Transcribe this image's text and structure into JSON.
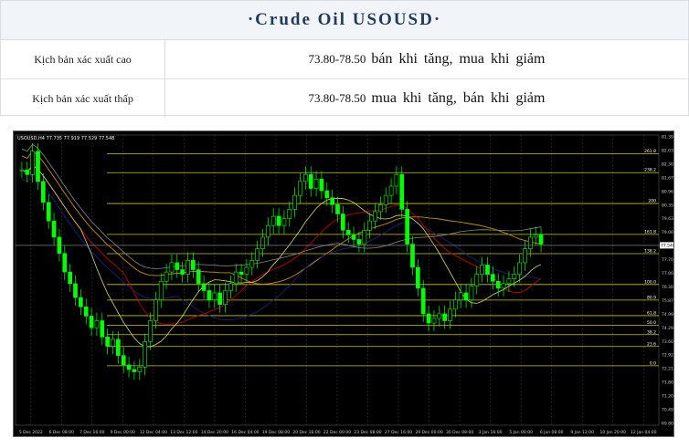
{
  "header": {
    "title": "·Crude  Oil  USOUSD·"
  },
  "scenarios": [
    {
      "label": "Kịch bản xác xuất cao",
      "range": "73.80-78.50",
      "action": "bán khi tăng, mua khi giảm"
    },
    {
      "label": "Kịch bản xác xuất thấp",
      "range": "73.80-78.50",
      "action": "mua khi tăng, bán khi giảm"
    }
  ],
  "colors": {
    "fib_line": "#c8c800",
    "candle": "#00ff00",
    "background": "#000000",
    "ma_red": "#c00000",
    "ma_orange": "#c89000",
    "ma_yellow": "#d8d860",
    "ma_grey": "#888888",
    "ma_blue": "#202080"
  },
  "chart_data": {
    "type": "candlestick",
    "symbol_info": "USOUSD,H4  77.735 77.919 77.529 77.548",
    "current_price": "77.548",
    "price_axis": [
      "81.390",
      "82.030",
      "82.305",
      "81.670",
      "80.960",
      "80.350",
      "79.635",
      "79.000",
      "78.410",
      "77.705",
      "77.005",
      "76.300",
      "75.870",
      "74.990",
      "74.290",
      "73.605",
      "72.920",
      "72.215",
      "71.800",
      "71.200",
      "70.495",
      "69.800"
    ],
    "fib_levels": [
      {
        "label": "261.8",
        "price": 81.5
      },
      {
        "label": "238.2",
        "price": 80.68
      },
      {
        "label": "200",
        "price": 79.35
      },
      {
        "label": "161.8",
        "price": 78.02
      },
      {
        "label": "138.2",
        "price": 77.19
      },
      {
        "label": "100.0",
        "price": 75.86
      },
      {
        "label": "80.9",
        "price": 75.19
      },
      {
        "label": "61.8",
        "price": 74.52
      },
      {
        "label": "50.0",
        "price": 74.11
      },
      {
        "label": "38.2",
        "price": 73.7
      },
      {
        "label": "23.6",
        "price": 73.19
      },
      {
        "label": "0.0",
        "price": 72.36
      }
    ],
    "ylim": [
      69.8,
      82.3
    ],
    "x_labels": [
      "5 Dec 2022",
      "6 Dec 08:00",
      "7 Dec 16:00",
      "9 Dec 00:00",
      "12 Dec 04:00",
      "13 Dec 12:00",
      "14 Dec 20:00",
      "16 Dec 04:00",
      "19 Dec 08:00",
      "20 Dec 16:00",
      "22 Dec 00:00",
      "23 Dec 08:00",
      "27 Dec 16:00",
      "29 Dec 00:00",
      "30 Dec 08:00",
      "3 Jan 16:00",
      "5 Jan 00:00",
      "6 Jan 08:00",
      "9 Jan 12:00",
      "10 Jan 20:00",
      "12 Jan 04:00"
    ],
    "closes": [
      80.8,
      80.6,
      81.6,
      80.3,
      79.4,
      78.6,
      77.9,
      77.2,
      76.4,
      75.9,
      75.3,
      74.9,
      74.5,
      74.0,
      74.3,
      73.6,
      73.2,
      73.5,
      72.8,
      72.4,
      72.2,
      72.1,
      72.3,
      73.4,
      74.3,
      75.2,
      76.0,
      76.4,
      76.8,
      76.5,
      76.3,
      76.9,
      76.5,
      75.9,
      75.6,
      75.2,
      75.5,
      75.0,
      75.6,
      75.9,
      76.4,
      76.3,
      76.6,
      76.9,
      77.4,
      77.9,
      78.4,
      78.8,
      78.4,
      78.7,
      79.1,
      79.7,
      80.3,
      80.6,
      80.0,
      80.4,
      79.9,
      79.6,
      79.3,
      78.9,
      78.2,
      78.0,
      77.8,
      77.6,
      78.2,
      78.6,
      79.0,
      79.3,
      79.7,
      80.1,
      80.6,
      79.1,
      77.6,
      76.6,
      75.7,
      74.6,
      74.2,
      74.4,
      74.6,
      74.3,
      74.8,
      75.2,
      75.5,
      75.2,
      75.8,
      76.3,
      76.7,
      76.3,
      76.0,
      75.7,
      75.9,
      76.1,
      76.3,
      76.8,
      77.4,
      77.9,
      78.0,
      77.6
    ]
  }
}
